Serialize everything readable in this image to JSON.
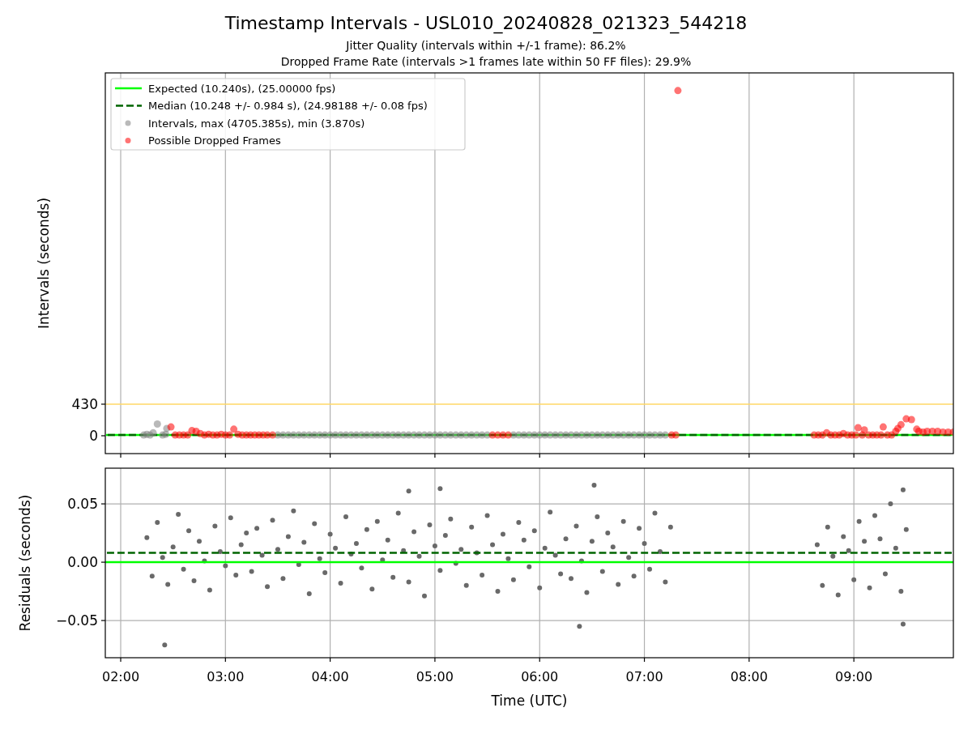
{
  "figure": {
    "title": "Timestamp Intervals - USL010_20240828_021323_544218",
    "subtitles": [
      "Jitter Quality (intervals within +/-1 frame): 86.2%",
      "Dropped Frame Rate (intervals >1 frames late within 50 FF files): 29.9%"
    ]
  },
  "panels": [
    {
      "chart_data": {
        "type": "scatter",
        "grid": "x",
        "legend": "upper left",
        "ylabel": "Intervals (seconds)",
        "xlim": [
          1.853,
          9.95
        ],
        "ylim": [
          -243,
          4941
        ],
        "yticks": [
          {
            "value": 0,
            "label": "0"
          },
          {
            "value": 430,
            "label": "430"
          }
        ],
        "series": [
          {
            "name": "Expected (10.240s), (25.00000 fps)",
            "type": "line",
            "color": "#00ff00",
            "x": [
              1.86,
              9.94
            ],
            "values": [
              10,
              10
            ]
          },
          {
            "name": "Median (10.248 +/- 0.984 s), (24.98188 +/- 0.08 fps)",
            "type": "line",
            "line_style": "dashed",
            "color": "#006400",
            "x": [
              1.86,
              9.94
            ],
            "values": [
              10,
              10
            ]
          },
          {
            "name": "Intervals, max (4705.385s), min (3.870s)",
            "type": "scatter",
            "color": "#808080",
            "x": [
              2.22,
              2.25,
              2.28,
              2.31,
              2.35,
              2.4,
              2.43,
              2.44,
              3.5,
              3.55,
              3.6,
              3.65,
              3.7,
              3.75,
              3.8,
              3.85,
              3.9,
              3.95,
              4,
              4.05,
              4.1,
              4.15,
              4.2,
              4.25,
              4.3,
              4.35,
              4.4,
              4.45,
              4.5,
              4.55,
              4.6,
              4.65,
              4.7,
              4.75,
              4.8,
              4.85,
              4.9,
              4.95,
              5,
              5.05,
              5.1,
              5.15,
              5.2,
              5.25,
              5.3,
              5.35,
              5.4,
              5.45,
              5.5,
              5.75,
              5.8,
              5.85,
              5.9,
              5.95,
              6,
              6.05,
              6.1,
              6.15,
              6.2,
              6.25,
              6.3,
              6.35,
              6.4,
              6.45,
              6.5,
              6.55,
              6.6,
              6.65,
              6.7,
              6.75,
              6.8,
              6.85,
              6.9,
              6.95,
              7,
              7.05,
              7.1,
              7.15,
              7.2
            ],
            "values": [
              10,
              20,
              10,
              40,
              160,
              10,
              20,
              100,
              10,
              10,
              10,
              10,
              10,
              10,
              10,
              10,
              10,
              10,
              10,
              10,
              10,
              10,
              10,
              10,
              10,
              10,
              10,
              10,
              10,
              10,
              10,
              10,
              10,
              10,
              10,
              10,
              10,
              10,
              10,
              10,
              10,
              10,
              10,
              10,
              10,
              10,
              10,
              10,
              10,
              10,
              10,
              10,
              10,
              10,
              10,
              10,
              10,
              10,
              10,
              10,
              10,
              10,
              10,
              10,
              10,
              10,
              10,
              10,
              10,
              10,
              10,
              10,
              10,
              10,
              10,
              10,
              10,
              10,
              10
            ]
          },
          {
            "name": "Possible Dropped Frames",
            "type": "scatter",
            "color": "#ff0000",
            "x": [
              2.48,
              2.52,
              2.56,
              2.6,
              2.64,
              2.68,
              2.72,
              2.76,
              2.8,
              2.84,
              2.88,
              2.92,
              2.96,
              3,
              3.04,
              3.08,
              3.12,
              3.16,
              3.2,
              3.24,
              3.28,
              3.32,
              3.36,
              3.4,
              3.45,
              5.55,
              5.6,
              5.65,
              5.7,
              7.26,
              7.3,
              7.32,
              8.62,
              8.66,
              8.7,
              8.74,
              8.78,
              8.82,
              8.86,
              8.9,
              8.94,
              8.98,
              9.02,
              9.04,
              9.08,
              9.1,
              9.14,
              9.18,
              9.22,
              9.26,
              9.28,
              9.32,
              9.36,
              9.4,
              9.42,
              9.45,
              9.5,
              9.55,
              9.6,
              9.62,
              9.66,
              9.7,
              9.75,
              9.8,
              9.85,
              9.9,
              9.95
            ],
            "values": [
              120,
              10,
              10,
              10,
              10,
              70,
              60,
              30,
              10,
              20,
              10,
              10,
              20,
              10,
              10,
              90,
              20,
              10,
              10,
              10,
              10,
              10,
              10,
              10,
              10,
              10,
              10,
              10,
              10,
              10,
              10,
              4700,
              10,
              10,
              10,
              40,
              10,
              10,
              10,
              30,
              10,
              10,
              10,
              110,
              10,
              80,
              10,
              10,
              10,
              10,
              120,
              10,
              10,
              60,
              100,
              150,
              230,
              220,
              90,
              60,
              50,
              60,
              60,
              60,
              50,
              50,
              50
            ]
          }
        ],
        "ref_lines": [
          {
            "axis": "y",
            "value": 430,
            "color": "#ffd966"
          }
        ]
      }
    },
    {
      "chart_data": {
        "type": "scatter",
        "grid": "both",
        "xlabel": "Time (UTC)",
        "ylabel": "Residuals (seconds)",
        "xlim": [
          1.853,
          9.95
        ],
        "ylim": [
          -0.0819,
          0.0806
        ],
        "xticks": [
          {
            "value": 2,
            "label": "02:00"
          },
          {
            "value": 3,
            "label": "03:00"
          },
          {
            "value": 4,
            "label": "04:00"
          },
          {
            "value": 5,
            "label": "05:00"
          },
          {
            "value": 6,
            "label": "06:00"
          },
          {
            "value": 7,
            "label": "07:00"
          },
          {
            "value": 8,
            "label": "08:00"
          },
          {
            "value": 9,
            "label": "09:00"
          }
        ],
        "yticks": [
          {
            "value": -0.05,
            "label": "−0.05"
          },
          {
            "value": 0,
            "label": "0.00"
          },
          {
            "value": 0.05,
            "label": "0.05"
          }
        ],
        "series": [
          {
            "type": "line",
            "color": "#00ff00",
            "x": [
              1.853,
              9.95
            ],
            "values": [
              0,
              0
            ]
          },
          {
            "type": "line",
            "line_style": "dashed",
            "color": "#006400",
            "x": [
              1.853,
              9.95
            ],
            "values": [
              0.008,
              0.008
            ]
          },
          {
            "type": "scatter",
            "color": "#696969",
            "x": [
              2.25,
              2.3,
              2.35,
              2.4,
              2.45,
              2.5,
              2.55,
              2.6,
              2.65,
              2.7,
              2.75,
              2.8,
              2.85,
              2.9,
              2.95,
              3,
              3.05,
              3.1,
              3.15,
              3.2,
              3.25,
              3.3,
              3.35,
              3.4,
              3.45,
              3.5,
              3.55,
              3.6,
              3.65,
              3.7,
              3.75,
              3.8,
              3.85,
              3.9,
              3.95,
              4,
              4.05,
              4.1,
              4.15,
              4.2,
              4.25,
              4.3,
              4.35,
              4.4,
              4.45,
              4.5,
              4.55,
              4.6,
              4.65,
              4.7,
              4.75,
              4.8,
              4.85,
              4.9,
              4.95,
              5,
              5.05,
              5.1,
              5.15,
              5.2,
              5.25,
              5.3,
              5.35,
              5.4,
              5.45,
              5.5,
              5.55,
              5.6,
              5.65,
              5.7,
              5.75,
              5.8,
              5.85,
              5.9,
              5.95,
              6,
              6.05,
              6.1,
              6.15,
              6.2,
              6.25,
              6.3,
              6.35,
              6.4,
              6.45,
              6.5,
              6.55,
              6.6,
              6.65,
              6.7,
              6.75,
              6.8,
              6.85,
              6.9,
              6.95,
              7,
              7.05,
              7.1,
              7.15,
              7.2,
              7.25,
              8.65,
              8.7,
              8.75,
              8.8,
              8.85,
              8.9,
              8.95,
              9,
              9.05,
              9.1,
              9.15,
              9.2,
              9.25,
              9.3,
              9.35,
              9.4,
              9.45,
              9.5,
              2.42,
              4.75,
              5.05,
              6.38,
              6.52,
              9.47,
              9.47
            ],
            "values": [
              0.021,
              -0.012,
              0.034,
              0.004,
              -0.019,
              0.013,
              0.041,
              -0.006,
              0.027,
              -0.016,
              0.018,
              0.001,
              -0.024,
              0.031,
              0.009,
              -0.003,
              0.038,
              -0.011,
              0.015,
              0.025,
              -0.008,
              0.029,
              0.006,
              -0.021,
              0.036,
              0.011,
              -0.014,
              0.022,
              0.044,
              -0.002,
              0.017,
              -0.027,
              0.033,
              0.003,
              -0.009,
              0.024,
              0.012,
              -0.018,
              0.039,
              0.007,
              0.016,
              -0.005,
              0.028,
              -0.023,
              0.035,
              0.002,
              0.019,
              -0.013,
              0.042,
              0.01,
              -0.017,
              0.026,
              0.005,
              -0.029,
              0.032,
              0.014,
              -0.007,
              0.023,
              0.037,
              -0.001,
              0.011,
              -0.02,
              0.03,
              0.008,
              -0.011,
              0.04,
              0.015,
              -0.025,
              0.024,
              0.003,
              -0.015,
              0.034,
              0.019,
              -0.004,
              0.027,
              -0.022,
              0.012,
              0.043,
              0.006,
              -0.01,
              0.02,
              -0.014,
              0.031,
              0.001,
              -0.026,
              0.018,
              0.039,
              -0.008,
              0.025,
              0.013,
              -0.019,
              0.035,
              0.004,
              -0.012,
              0.029,
              0.016,
              -0.006,
              0.042,
              0.009,
              -0.017,
              0.03,
              0.015,
              -0.02,
              0.03,
              0.005,
              -0.028,
              0.022,
              0.01,
              -0.015,
              0.035,
              0.018,
              -0.022,
              0.04,
              0.02,
              -0.01,
              0.05,
              0.012,
              -0.025,
              0.028,
              -0.071,
              0.061,
              0.063,
              -0.055,
              0.066,
              0.062,
              -0.053
            ]
          }
        ]
      }
    }
  ]
}
